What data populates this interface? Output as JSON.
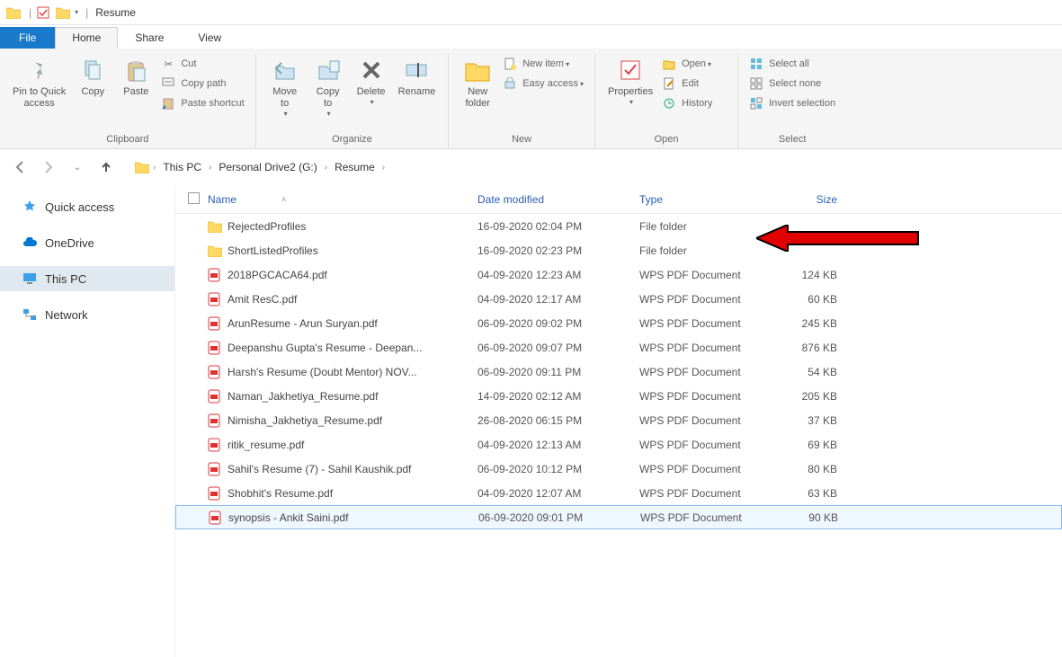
{
  "window": {
    "title": "Resume"
  },
  "tabs": {
    "file": "File",
    "home": "Home",
    "share": "Share",
    "view": "View"
  },
  "ribbon": {
    "clipboard": {
      "pin": "Pin to Quick\naccess",
      "copy": "Copy",
      "paste": "Paste",
      "cut": "Cut",
      "copy_path": "Copy path",
      "paste_shortcut": "Paste shortcut",
      "label": "Clipboard"
    },
    "organize": {
      "move": "Move\nto",
      "copy": "Copy\nto",
      "delete": "Delete",
      "rename": "Rename",
      "label": "Organize"
    },
    "new": {
      "folder": "New\nfolder",
      "item": "New item",
      "easy_access": "Easy access",
      "label": "New"
    },
    "open": {
      "properties": "Properties",
      "open": "Open",
      "edit": "Edit",
      "history": "History",
      "label": "Open"
    },
    "select": {
      "all": "Select all",
      "none": "Select none",
      "invert": "Invert selection",
      "label": "Select"
    }
  },
  "breadcrumb": [
    "This PC",
    "Personal Drive2 (G:)",
    "Resume"
  ],
  "columns": {
    "name": "Name",
    "date": "Date modified",
    "type": "Type",
    "size": "Size"
  },
  "sidebar": [
    {
      "key": "quick",
      "label": "Quick access",
      "icon": "star",
      "color": "#3ea0e8"
    },
    {
      "key": "onedrive",
      "label": "OneDrive",
      "icon": "cloud",
      "color": "#0078d4"
    },
    {
      "key": "thispc",
      "label": "This PC",
      "icon": "monitor",
      "color": "#3ea0e8",
      "selected": true
    },
    {
      "key": "network",
      "label": "Network",
      "icon": "network",
      "color": "#3ea0e8"
    }
  ],
  "files": [
    {
      "icon": "folder",
      "name": "RejectedProfiles",
      "date": "16-09-2020 02:04 PM",
      "type": "File folder",
      "size": ""
    },
    {
      "icon": "folder",
      "name": "ShortListedProfiles",
      "date": "16-09-2020 02:23 PM",
      "type": "File folder",
      "size": ""
    },
    {
      "icon": "pdf",
      "name": "2018PGCACA64.pdf",
      "date": "04-09-2020 12:23 AM",
      "type": "WPS PDF Document",
      "size": "124 KB"
    },
    {
      "icon": "pdf",
      "name": "Amit ResC.pdf",
      "date": "04-09-2020 12:17 AM",
      "type": "WPS PDF Document",
      "size": "60 KB"
    },
    {
      "icon": "pdf",
      "name": "ArunResume - Arun Suryan.pdf",
      "date": "06-09-2020 09:02 PM",
      "type": "WPS PDF Document",
      "size": "245 KB"
    },
    {
      "icon": "pdf",
      "name": "Deepanshu Gupta's Resume - Deepan...",
      "date": "06-09-2020 09:07 PM",
      "type": "WPS PDF Document",
      "size": "876 KB"
    },
    {
      "icon": "pdf",
      "name": "Harsh's Resume (Doubt Mentor) NOV...",
      "date": "06-09-2020 09:11 PM",
      "type": "WPS PDF Document",
      "size": "54 KB"
    },
    {
      "icon": "pdf",
      "name": "Naman_Jakhetiya_Resume.pdf",
      "date": "14-09-2020 02:12 AM",
      "type": "WPS PDF Document",
      "size": "205 KB"
    },
    {
      "icon": "pdf",
      "name": "Nimisha_Jakhetiya_Resume.pdf",
      "date": "26-08-2020 06:15 PM",
      "type": "WPS PDF Document",
      "size": "37 KB"
    },
    {
      "icon": "pdf",
      "name": "ritik_resume.pdf",
      "date": "04-09-2020 12:13 AM",
      "type": "WPS PDF Document",
      "size": "69 KB"
    },
    {
      "icon": "pdf",
      "name": "Sahil's Resume (7) - Sahil Kaushik.pdf",
      "date": "06-09-2020 10:12 PM",
      "type": "WPS PDF Document",
      "size": "80 KB"
    },
    {
      "icon": "pdf",
      "name": "Shobhit's Resume.pdf",
      "date": "04-09-2020 12:07 AM",
      "type": "WPS PDF Document",
      "size": "63 KB"
    },
    {
      "icon": "pdf",
      "name": "synopsis - Ankit Saini.pdf",
      "date": "06-09-2020 09:01 PM",
      "type": "WPS PDF Document",
      "size": "90 KB",
      "selected": true
    }
  ]
}
